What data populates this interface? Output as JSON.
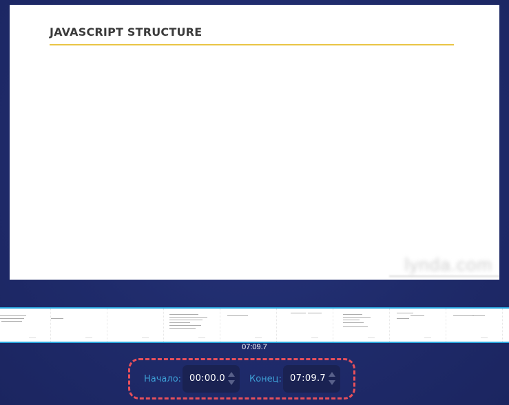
{
  "slide": {
    "title": "JAVASCRIPT STRUCTURE",
    "watermark": "lynda.com"
  },
  "timeline": {
    "duration": "07:09.7"
  },
  "trim": {
    "start_label": "Начало:",
    "start_value": "00:00.0",
    "end_label": "Конец:",
    "end_value": "07:09.7"
  },
  "colors": {
    "background": "#1f2b6b",
    "accent": "#2aa6dd",
    "highlight": "#e8505b",
    "label": "#3e9fd6",
    "rule": "#e9c545"
  }
}
